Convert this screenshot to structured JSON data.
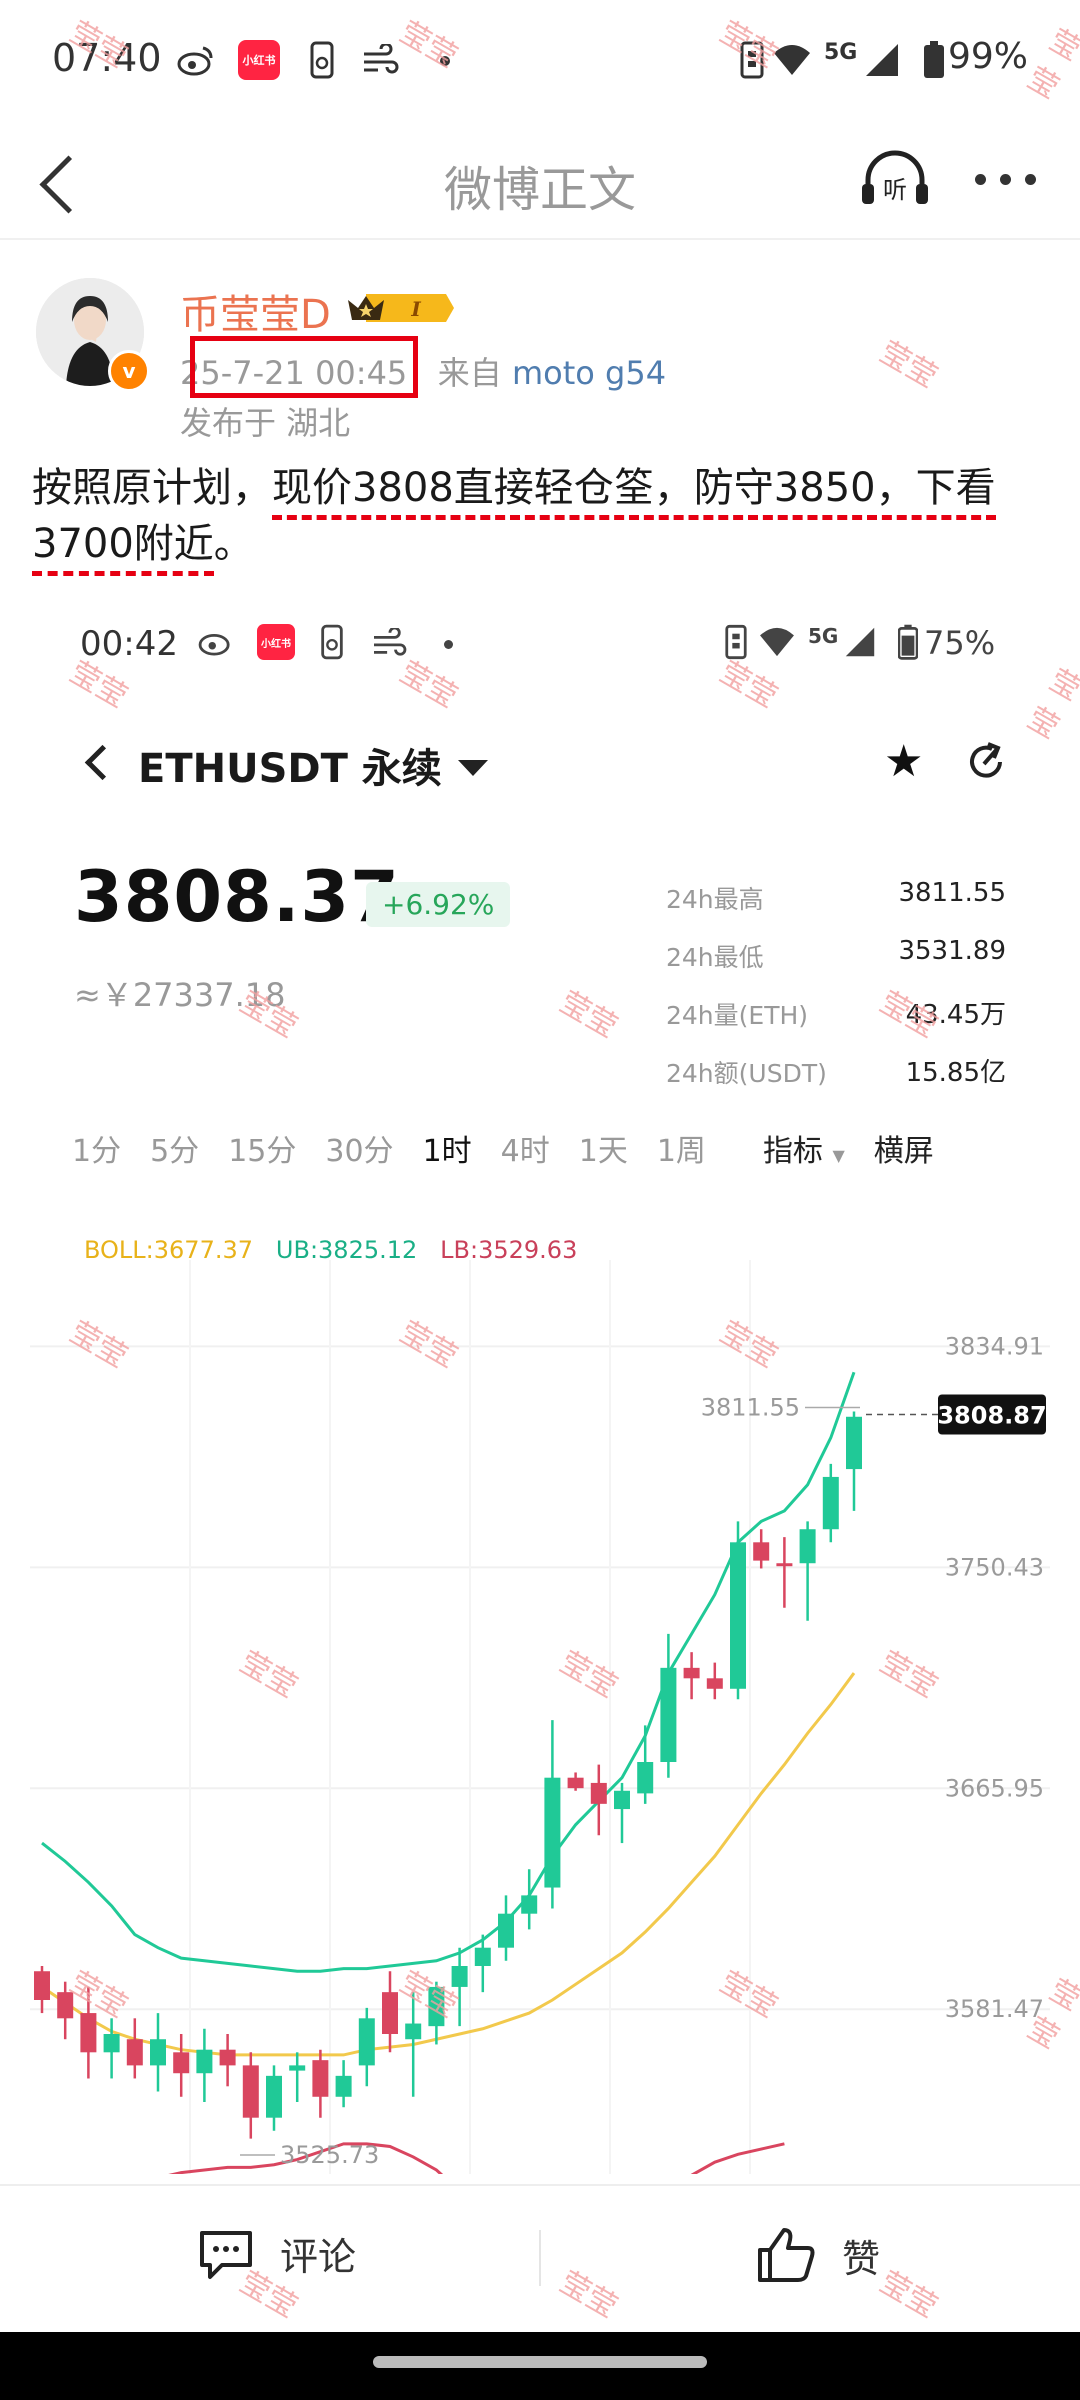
{
  "status_bar": {
    "time": "07:40",
    "xhs_label": "小红书",
    "network": "5G",
    "battery": "99%"
  },
  "header": {
    "title": "微博正文"
  },
  "post": {
    "author": "币莹莹D",
    "member_badge": "I",
    "timestamp": "25-7-21 00:45",
    "source_prefix": "来自",
    "device": "moto g54",
    "location": "发布于 湖北",
    "text_before": "按照原计划，",
    "text_underlined": "现价3808直接轻仓筌，防守3850，下看3700附近",
    "text_after": "。"
  },
  "screenshot": {
    "status_time": "00:42",
    "xhs_label": "小红书",
    "network": "5G",
    "battery": "75%",
    "pair": "ETHUSDT 永续",
    "last_price": "3808.37",
    "change": "+6.92%",
    "cny_price": "≈￥27337.18",
    "stats": [
      {
        "label": "24h最高",
        "value": "3811.55"
      },
      {
        "label": "24h最低",
        "value": "3531.89"
      },
      {
        "label": "24h量(ETH)",
        "value": "43.45万"
      },
      {
        "label": "24h额(USDT)",
        "value": "15.85亿"
      }
    ],
    "timeframes": [
      "1分",
      "5分",
      "15分",
      "30分",
      "1时",
      "4时",
      "1天",
      "1周"
    ],
    "active_timeframe": "1时",
    "indicator_label": "指标",
    "landscape_label": "横屏",
    "boll_label": "BOLL:3677.37",
    "ub_label": "UB:3825.12",
    "lb_label": "LB:3529.63"
  },
  "chart_data": {
    "type": "candlestick",
    "y_ticks": [
      "3834.91",
      "3750.43",
      "3665.95",
      "3581.47"
    ],
    "high_marker": "3811.55",
    "low_marker": "3525.73",
    "current_price_tag": "3808.87",
    "ylim": [
      3520,
      3845
    ],
    "colors": {
      "up": "#20c997",
      "down": "#d9455f",
      "boll": "#f2c94c",
      "bands_ub": "#20c997",
      "bands_lb": "#d9455f"
    },
    "candles": [
      [
        3596,
        3598,
        3580,
        3585
      ],
      [
        3588,
        3592,
        3570,
        3578
      ],
      [
        3580,
        3590,
        3555,
        3565
      ],
      [
        3565,
        3578,
        3555,
        3572
      ],
      [
        3570,
        3578,
        3555,
        3560
      ],
      [
        3560,
        3580,
        3550,
        3570
      ],
      [
        3565,
        3572,
        3548,
        3557
      ],
      [
        3557,
        3574,
        3546,
        3566
      ],
      [
        3566,
        3572,
        3552,
        3560
      ],
      [
        3560,
        3565,
        3532,
        3540
      ],
      [
        3540,
        3560,
        3535,
        3556
      ],
      [
        3558,
        3565,
        3546,
        3560
      ],
      [
        3562,
        3566,
        3540,
        3548
      ],
      [
        3548,
        3562,
        3544,
        3556
      ],
      [
        3560,
        3582,
        3552,
        3578
      ],
      [
        3588,
        3596,
        3565,
        3572
      ],
      [
        3570,
        3588,
        3548,
        3576
      ],
      [
        3575,
        3592,
        3568,
        3590
      ],
      [
        3590,
        3605,
        3575,
        3598
      ],
      [
        3598,
        3610,
        3588,
        3605
      ],
      [
        3605,
        3625,
        3600,
        3618
      ],
      [
        3618,
        3635,
        3612,
        3625
      ],
      [
        3628,
        3692,
        3620,
        3670
      ],
      [
        3670,
        3672,
        3665,
        3666
      ],
      [
        3668,
        3675,
        3648,
        3660
      ],
      [
        3658,
        3668,
        3645,
        3665
      ],
      [
        3664,
        3690,
        3660,
        3676
      ],
      [
        3676,
        3725,
        3670,
        3712
      ],
      [
        3712,
        3718,
        3700,
        3708
      ],
      [
        3708,
        3714,
        3700,
        3704
      ],
      [
        3704,
        3768,
        3700,
        3760
      ],
      [
        3760,
        3765,
        3750,
        3753
      ],
      [
        3752,
        3762,
        3735,
        3751
      ],
      [
        3752,
        3768,
        3730,
        3765
      ],
      [
        3765,
        3790,
        3760,
        3785
      ],
      [
        3788,
        3810,
        3772,
        3808
      ]
    ],
    "boll": [
      3590,
      3584,
      3578,
      3573,
      3570,
      3568,
      3566,
      3565,
      3564,
      3564,
      3564,
      3564,
      3564,
      3564,
      3566,
      3567,
      3568,
      3570,
      3572,
      3574,
      3577,
      3580,
      3585,
      3591,
      3597,
      3603,
      3611,
      3620,
      3630,
      3640,
      3652,
      3664,
      3675,
      3687,
      3698,
      3710
    ],
    "upper_band": [
      3645,
      3638,
      3630,
      3621,
      3610,
      3605,
      3601,
      3600,
      3599,
      3598,
      3597,
      3596,
      3596,
      3597,
      3597,
      3598,
      3599,
      3600,
      3603,
      3608,
      3615,
      3625,
      3640,
      3652,
      3661,
      3670,
      3686,
      3710,
      3725,
      3740,
      3760,
      3768,
      3772,
      3782,
      3800,
      3825
    ],
    "lower_band": [
      3502,
      3500,
      3504,
      3510,
      3514,
      3517,
      3519,
      3520,
      3521,
      3521,
      3522,
      3524,
      3527,
      3530,
      3530,
      3529,
      3525,
      3520,
      3512,
      3508,
      3505,
      3503,
      3502,
      3502,
      3503,
      3505,
      3508,
      3514,
      3518,
      3523,
      3526,
      3528,
      3530
    ]
  },
  "watermark": "莹莹",
  "footer": {
    "comment": "评论",
    "like": "赞"
  }
}
